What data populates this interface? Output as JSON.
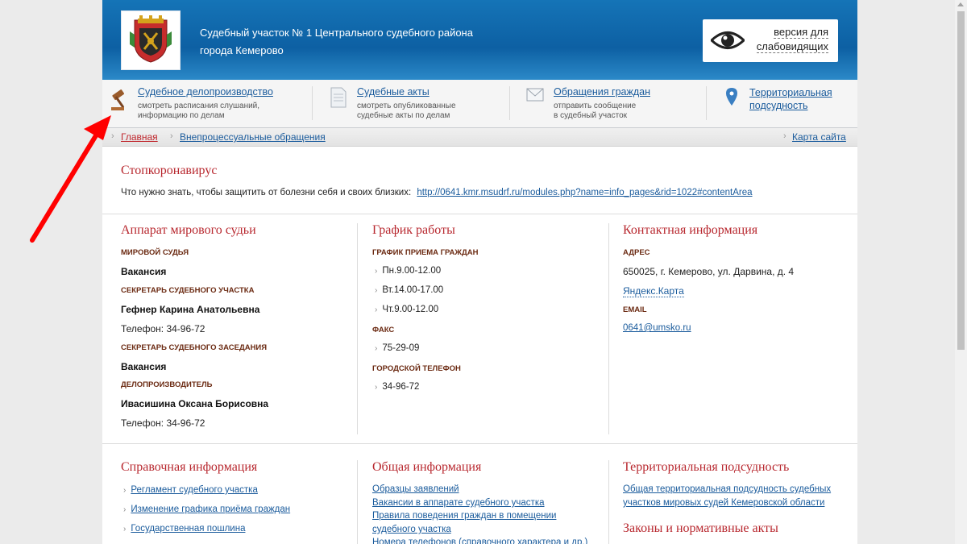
{
  "header": {
    "title_line1": "Судебный участок № 1 Центрального судебного района",
    "title_line2": "города Кемерово",
    "vision_line1": "версия для",
    "vision_line2": "слабовидящих"
  },
  "services": [
    {
      "label": "Судебное делопроизводство",
      "desc1": "смотреть расписания слушаний,",
      "desc2": "информацию по делам",
      "icon": "gavel-icon"
    },
    {
      "label": "Судебные акты",
      "desc1": "смотреть опубликованные",
      "desc2": "судебные акты по делам",
      "icon": "document-icon"
    },
    {
      "label": "Обращения граждан",
      "desc1": "отправить сообщение",
      "desc2": "в судебный участок",
      "icon": "envelope-icon"
    },
    {
      "label_line1": "Территориальная",
      "label_line2": "подсудность",
      "icon": "map-pin-icon"
    }
  ],
  "breadcrumb": {
    "home": "Главная",
    "current": "Внепроцессуальные обращения",
    "sitemap": "Карта сайта"
  },
  "notice": {
    "title": "Стопкоронавирус",
    "text": "Что нужно знать, чтобы защитить от болезни себя и своих близких:",
    "link": "http://0641.kmr.msudrf.ru/modules.php?name=info_pages&rid=1022#contentArea"
  },
  "apparatus": {
    "title": "Аппарат мирового судьи",
    "judge_label": "МИРОВОЙ СУДЬЯ",
    "judge_value": "Вакансия",
    "secretary_label": "СЕКРЕТАРЬ СУДЕБНОГО УЧАСТКА",
    "secretary_name": "Гефнер Карина Анатольевна",
    "secretary_phone": "Телефон:  34-96-72",
    "session_label": "СЕКРЕТАРЬ СУДЕБНОГО ЗАСЕДАНИЯ",
    "session_value": "Вакансия",
    "clerk_label": "ДЕЛОПРОИЗВОДИТЕЛЬ",
    "clerk_name": "Ивасишина Оксана Борисовна",
    "clerk_phone": "Телефон:  34-96-72"
  },
  "schedule": {
    "title": "График работы",
    "reception_label": "ГРАФИК ПРИЕМА ГРАЖДАН",
    "reception": [
      "Пн.9.00-12.00",
      "Вт.14.00-17.00",
      "Чт.9.00-12.00"
    ],
    "fax_label": "ФАКС",
    "fax": "75-29-09",
    "city_phone_label": "ГОРОДСКОЙ ТЕЛЕФОН",
    "city_phone": "34-96-72"
  },
  "contacts": {
    "title": "Контактная информация",
    "address_label": "АДРЕС",
    "address": "650025, г. Кемерово, ул. Дарвина, д. 4",
    "map_link": "Яндекс.Карта",
    "email_label": "EMAIL",
    "email": "0641@umsko.ru"
  },
  "reference": {
    "title": "Справочная информация",
    "links": [
      "Регламент судебного участка",
      "Изменение графика приёма граждан",
      "Государственная пошлина"
    ]
  },
  "general": {
    "title": "Общая информация",
    "links": [
      "Образцы заявлений",
      "Вакансии в аппарате судебного участка",
      "Правила поведения граждан в помещении",
      "судебного участка",
      "Номера телефонов (справочного характера и др.)"
    ]
  },
  "territorial": {
    "title": "Территориальная подсудность",
    "link_line1": "Общая территориальная подсудность судебных",
    "link_line2": "участков мировых судей Кемеровской области",
    "laws_title": "Законы и нормативные акты"
  },
  "colors": {
    "header_blue": "#1574b7",
    "section_title_red": "#b8282f",
    "link_blue": "#1a5b9c",
    "label_brown": "#6b2a12",
    "annotation_red": "#ff0000"
  }
}
